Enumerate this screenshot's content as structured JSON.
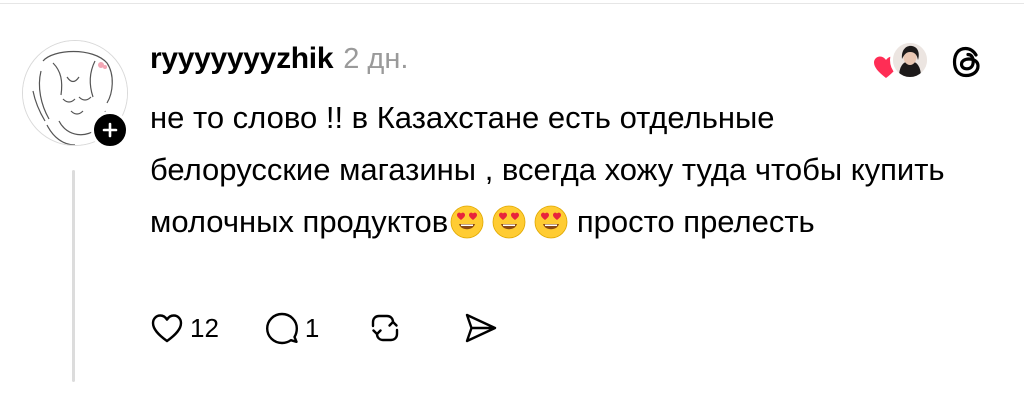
{
  "comment": {
    "username": "ryyyyyyyzhik",
    "timestamp": "2 дн.",
    "text": "не то слово !! в Казахстане есть отдельные белорусские магазины , всегда хожу туда чтобы купить молочных продуктов",
    "text_tail": "просто прелесть",
    "emojis": [
      "smiling-face-with-heart-eyes",
      "smiling-face-with-heart-eyes",
      "smiling-face-with-heart-eyes"
    ]
  },
  "actions": {
    "like_count": "12",
    "reply_count": "1"
  },
  "icons": {
    "like": "heart-outline-icon",
    "reply": "speech-bubble-icon",
    "repost": "repost-arrows-icon",
    "share": "send-icon",
    "app": "threads-logo-icon",
    "follow": "plus-icon"
  },
  "colors": {
    "text": "#000000",
    "muted": "#9a9a9a",
    "heart": "#ff2d55",
    "thread_line": "#dcdcdc"
  }
}
